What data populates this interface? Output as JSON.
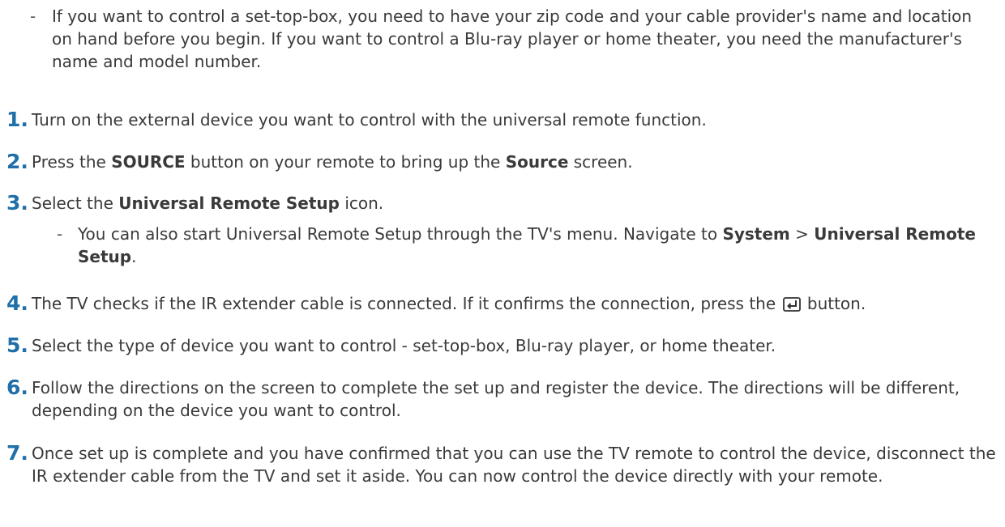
{
  "note_top": {
    "dash": "-",
    "text": "If you want to control a set-top-box, you need to have your zip code and your cable provider's name and location on hand before you begin. If you want to control a Blu-ray player or home theater, you need the manufacturer's name and model number."
  },
  "steps": [
    {
      "number": "1.",
      "text": "Turn on the external device you want to control with the universal remote function."
    },
    {
      "number": "2.",
      "pre": "Press the ",
      "bold1": "SOURCE",
      "mid": " button on your remote to bring up the ",
      "bold2": "Source",
      "post": " screen."
    },
    {
      "number": "3.",
      "pre": "Select the ",
      "bold1": "Universal Remote Setup",
      "post": " icon.",
      "subnote": {
        "dash": "-",
        "pre": "You can also start Universal Remote Setup through the TV's menu. Navigate to ",
        "bold1": "System",
        "sep": " > ",
        "bold2": "Universal Remote Setup",
        "post": "."
      }
    },
    {
      "number": "4.",
      "pre": "The TV checks if the IR extender cable is connected. If it confirms the connection, press the ",
      "icon": "enter-icon",
      "post": " button."
    },
    {
      "number": "5.",
      "text": "Select the type of device you want to control - set-top-box, Blu-ray player, or home theater."
    },
    {
      "number": "6.",
      "text": "Follow the directions on the screen to complete the set up and register the device. The directions will be different, depending on the device you want to control."
    },
    {
      "number": "7.",
      "text": "Once set up is complete and you have confirmed that you can use the TV remote to control the device, disconnect the IR extender cable from the TV and set it aside. You can now control the device directly with your remote."
    }
  ],
  "colors": {
    "step_number": "#1f6fa8",
    "body_text": "#3a3a3a"
  }
}
